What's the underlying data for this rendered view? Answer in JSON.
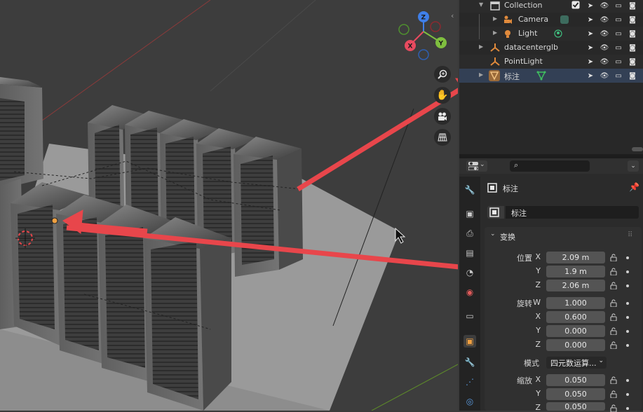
{
  "outliner": {
    "rows": [
      {
        "name": "Collection",
        "type": "collection"
      },
      {
        "name": "Camera",
        "type": "camera"
      },
      {
        "name": "Light",
        "type": "light"
      },
      {
        "name": "datacenterglb",
        "type": "empty"
      },
      {
        "name": "PointLight",
        "type": "empty"
      },
      {
        "name": "标注",
        "type": "mesh"
      }
    ]
  },
  "viewport": {
    "gizmo": {
      "x": "X",
      "y": "Y",
      "z": "Z"
    },
    "nav_icons": [
      "zoom-icon",
      "hand-icon",
      "camera-icon",
      "grid-icon"
    ]
  },
  "properties": {
    "search_placeholder": "",
    "object_name": "标注",
    "data_name": "标注",
    "panel_title": "变换",
    "location": {
      "label": "位置",
      "axis_x": "X",
      "axis_y": "Y",
      "axis_z": "Z",
      "x": "2.09 m",
      "y": "1.9 m",
      "z": "2.06 m"
    },
    "rotation": {
      "label": "旋转",
      "axis_w": "W",
      "axis_x": "X",
      "axis_y": "Y",
      "axis_z": "Z",
      "w": "1.000",
      "x": "0.600",
      "y": "0.000",
      "z": "0.000"
    },
    "mode": {
      "label": "模式",
      "value": "四元数运算..."
    },
    "scale": {
      "label": "缩放",
      "axis_x": "X",
      "axis_y": "Y",
      "axis_z": "Z",
      "x": "0.050",
      "y": "0.050",
      "z": "0.050"
    }
  },
  "colors": {
    "annotation_arrow": "#e8464b",
    "selection_highlight": "#334055",
    "axis_x": "#e84a5f",
    "axis_y": "#7fbf3f",
    "axis_z": "#3f7fe8"
  }
}
